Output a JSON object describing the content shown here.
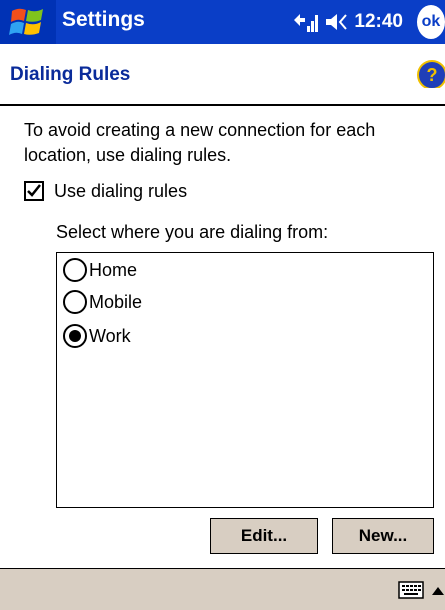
{
  "titlebar": {
    "app_title": "Settings",
    "clock": "12:40",
    "ok_label": "ok"
  },
  "header": {
    "page_title": "Dialing Rules",
    "help_symbol": "?"
  },
  "content": {
    "description": "To avoid creating a new connection for each location, use dialing rules.",
    "checkbox_label": "Use dialing rules",
    "checkbox_checked": true,
    "select_label": "Select where you are dialing from:",
    "options": [
      {
        "label": "Home",
        "selected": false
      },
      {
        "label": "Mobile",
        "selected": false
      },
      {
        "label": "Work",
        "selected": true
      }
    ]
  },
  "buttons": {
    "edit": "Edit...",
    "new": "New..."
  },
  "colors": {
    "titlebar": "#0a3ec7",
    "header_text": "#0a2b9a",
    "button_bg": "#d8cec2",
    "menubar": "#d8cec2"
  },
  "icons": {
    "start": "windows-flag-icon",
    "signal": "connectivity-icon",
    "volume": "speaker-icon",
    "help": "help-icon",
    "keyboard": "keyboard-icon"
  }
}
